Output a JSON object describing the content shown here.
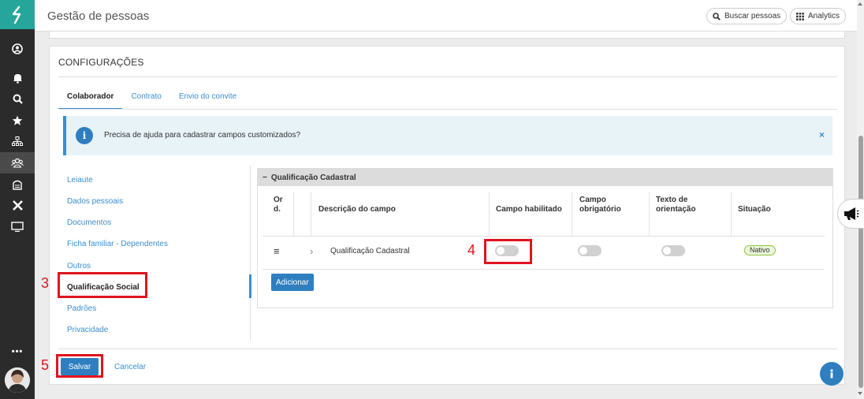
{
  "app": {
    "title": "Gestão de pessoas"
  },
  "header": {
    "search_label": "Buscar pessoas",
    "analytics_label": "Analytics"
  },
  "rail": {
    "icons": [
      "user-circle-icon",
      "bell-icon",
      "search-icon",
      "star-icon",
      "org-chart-icon",
      "people-icon",
      "building-icon",
      "x-icon",
      "monitor-icon"
    ],
    "more_label": "•••"
  },
  "section": {
    "title": "CONFIGURAÇÕES"
  },
  "tabs": [
    {
      "label": "Colaborador",
      "active": true
    },
    {
      "label": "Contrato",
      "active": false
    },
    {
      "label": "Envio do convite",
      "active": false
    }
  ],
  "alert": {
    "icon": "i",
    "text": "Precisa de ajuda para cadastrar campos customizados?",
    "close": "×"
  },
  "menu": {
    "items": [
      {
        "label": "Leiaute"
      },
      {
        "label": "Dados pessoais"
      },
      {
        "label": "Documentos"
      },
      {
        "label": "Ficha familiar - Dependentes"
      },
      {
        "label": "Outros"
      },
      {
        "label": "Qualificação Social",
        "active": true
      },
      {
        "label": "Padrões"
      },
      {
        "label": "Privacidade"
      }
    ]
  },
  "panel": {
    "collapse_icon": "−",
    "title": "Qualificação Cadastral",
    "columns": {
      "order_l1": "Or",
      "order_l2": "d.",
      "description": "Descrição do campo",
      "enabled": "Campo habilitado",
      "required_l1": "Campo",
      "required_l2": "obrigatório",
      "guidance_l1": "Texto de",
      "guidance_l2": "orientação",
      "status": "Situação"
    },
    "rows": [
      {
        "drag": "≡",
        "expand": "›",
        "description": "Qualificação Cadastral",
        "enabled": false,
        "required": false,
        "guidance": false,
        "status": "Nativo"
      }
    ],
    "add_label": "Adicionar"
  },
  "footer": {
    "save_label": "Salvar",
    "cancel_label": "Cancelar"
  },
  "annotations": {
    "n3": "3",
    "n4": "4",
    "n5": "5",
    "color": "#e0141e"
  },
  "colors": {
    "accent": "#2f7fc0",
    "logo": "#26a69a",
    "rail": "#2b2b2b",
    "nativo": "#8cc63f"
  }
}
